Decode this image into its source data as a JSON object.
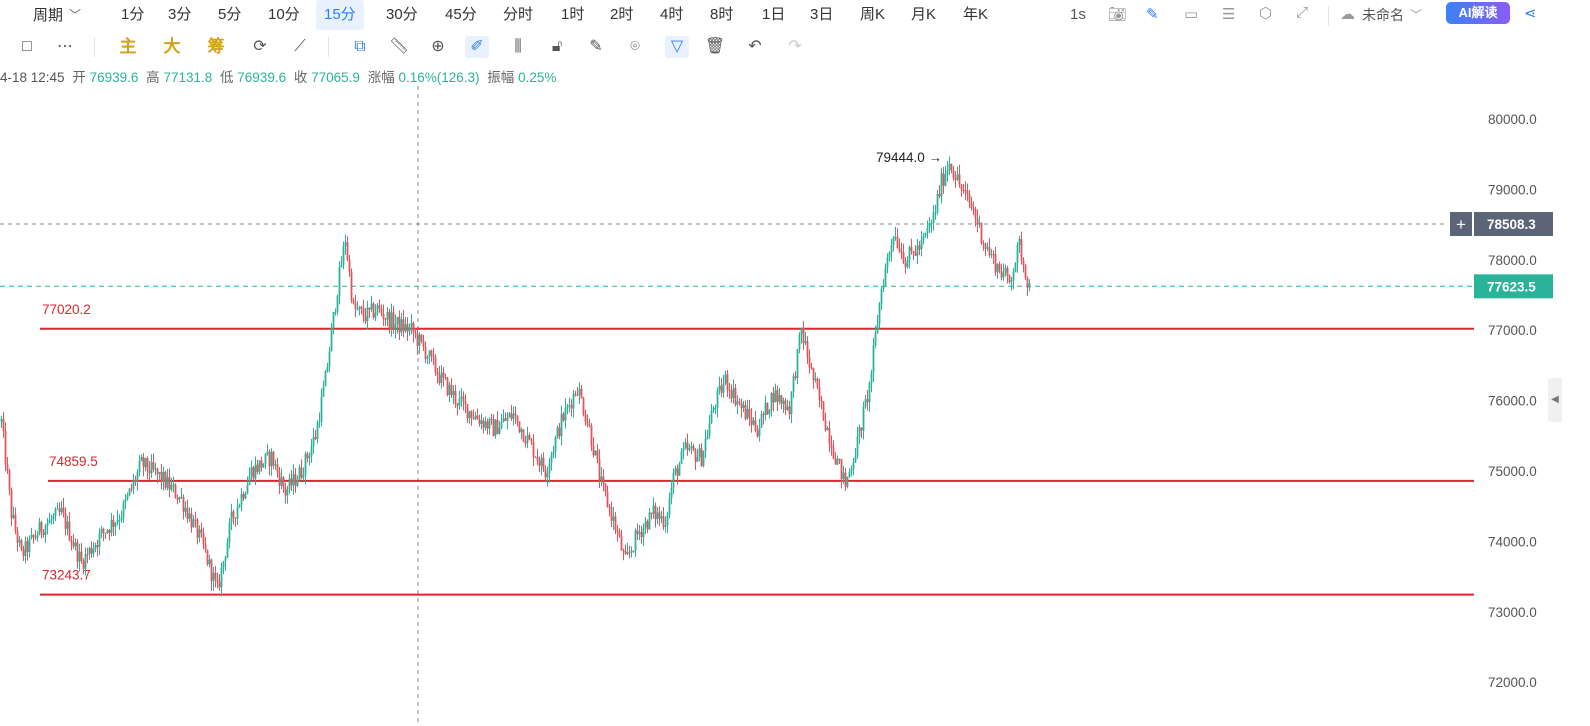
{
  "topbar": {
    "period_label": "周期",
    "tabs": [
      "1分",
      "3分",
      "5分",
      "10分",
      "15分",
      "30分",
      "45分",
      "分时",
      "1时",
      "2时",
      "4时",
      "8时",
      "1日",
      "3日",
      "周K",
      "月K",
      "年K"
    ],
    "active_tab": "15分",
    "refresh_label": "1s",
    "layout_name": "未命名",
    "ai_button": "AI解读"
  },
  "toolbar": {
    "main_label": "主",
    "big_label": "大",
    "chips_label": "筹"
  },
  "ohlc": {
    "datetime": "4-18 12:45",
    "open_label": "开",
    "open": "76939.6",
    "high_label": "高",
    "high": "77131.8",
    "low_label": "低",
    "low": "76939.6",
    "close_label": "收",
    "close": "77065.9",
    "change_label": "涨幅",
    "change": "0.16%(126.3)",
    "amplitude_label": "振幅",
    "amplitude": "0.25%"
  },
  "price_axis": {
    "ticks": [
      "80000.0",
      "79000.0",
      "78000.0",
      "77000.0",
      "76000.0",
      "75000.0",
      "74000.0",
      "73000.0",
      "72000.0"
    ]
  },
  "crosshair": {
    "price": "78508.3"
  },
  "last_price": {
    "value": "77623.5"
  },
  "annotations": {
    "high_marker": "79444.0",
    "lines": [
      {
        "label": "77020.2",
        "price": 77020.2
      },
      {
        "label": "74859.5",
        "price": 74859.5
      },
      {
        "label": "73243.7",
        "price": 73243.7
      }
    ]
  },
  "colors": {
    "up": "#2bb39a",
    "down": "#e5535b",
    "support_line": "#d9262f",
    "accent": "#2d7ff9",
    "last_price_bg": "#2bb39a",
    "crosshair_label_bg": "#5b6577"
  },
  "chart_data": {
    "type": "candlestick",
    "ylim": [
      71700,
      80600
    ],
    "anchors": [
      [
        0,
        75700
      ],
      [
        5,
        74400
      ],
      [
        10,
        73800
      ],
      [
        20,
        74200
      ],
      [
        30,
        74400
      ],
      [
        40,
        73700
      ],
      [
        50,
        74100
      ],
      [
        60,
        74400
      ],
      [
        70,
        75100
      ],
      [
        80,
        74900
      ],
      [
        90,
        74600
      ],
      [
        100,
        74000
      ],
      [
        108,
        73300
      ],
      [
        115,
        74300
      ],
      [
        125,
        75000
      ],
      [
        135,
        75200
      ],
      [
        142,
        74700
      ],
      [
        150,
        75000
      ],
      [
        157,
        75500
      ],
      [
        162,
        76300
      ],
      [
        168,
        77600
      ],
      [
        172,
        78300
      ],
      [
        176,
        77300
      ],
      [
        182,
        77200
      ],
      [
        188,
        77300
      ],
      [
        196,
        77100
      ],
      [
        205,
        77000
      ],
      [
        212,
        76700
      ],
      [
        220,
        76300
      ],
      [
        228,
        76000
      ],
      [
        236,
        75800
      ],
      [
        246,
        75600
      ],
      [
        256,
        75800
      ],
      [
        264,
        75400
      ],
      [
        272,
        75000
      ],
      [
        280,
        75700
      ],
      [
        288,
        76200
      ],
      [
        294,
        75600
      ],
      [
        300,
        74800
      ],
      [
        306,
        74300
      ],
      [
        312,
        73700
      ],
      [
        318,
        74100
      ],
      [
        326,
        74400
      ],
      [
        332,
        74300
      ],
      [
        336,
        74900
      ],
      [
        342,
        75300
      ],
      [
        350,
        75200
      ],
      [
        356,
        75900
      ],
      [
        362,
        76300
      ],
      [
        370,
        75900
      ],
      [
        378,
        75600
      ],
      [
        386,
        76100
      ],
      [
        394,
        75900
      ],
      [
        400,
        77000
      ],
      [
        405,
        76400
      ],
      [
        410,
        75900
      ],
      [
        416,
        75300
      ],
      [
        422,
        74800
      ],
      [
        428,
        75400
      ],
      [
        434,
        76200
      ],
      [
        440,
        77600
      ],
      [
        446,
        78400
      ],
      [
        452,
        78000
      ],
      [
        460,
        78200
      ],
      [
        466,
        78600
      ],
      [
        470,
        79100
      ],
      [
        474,
        79400
      ],
      [
        480,
        79000
      ],
      [
        486,
        78700
      ],
      [
        492,
        78200
      ],
      [
        498,
        77900
      ],
      [
        504,
        77700
      ],
      [
        509,
        78200
      ],
      [
        514,
        77600
      ]
    ]
  }
}
